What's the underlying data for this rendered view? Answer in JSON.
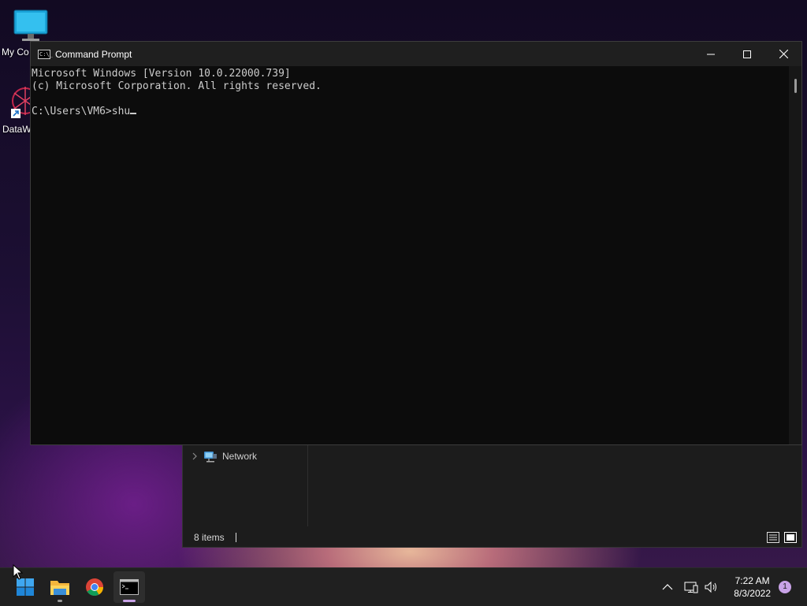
{
  "desktop": {
    "icons": [
      {
        "label": "My Co",
        "icon": "monitor-icon"
      },
      {
        "label": "DataW",
        "icon": "datawrangler-shortcut-icon"
      }
    ]
  },
  "explorer": {
    "nav": {
      "network_label": "Network"
    },
    "status": {
      "items_count": "8 items"
    }
  },
  "cmd": {
    "title": "Command Prompt",
    "icon_text": "C:\\_",
    "lines": [
      "Microsoft Windows [Version 10.0.22000.739]",
      "(c) Microsoft Corporation. All rights reserved.",
      "",
      "C:\\Users\\VM6>shu"
    ],
    "buttons": {
      "minimize": "minimize",
      "maximize": "maximize",
      "close": "close"
    }
  },
  "taskbar": {
    "apps": [
      {
        "name": "Start",
        "icon": "windows-start-icon"
      },
      {
        "name": "File Explorer",
        "icon": "folder-icon"
      },
      {
        "name": "Google Chrome",
        "icon": "chrome-icon"
      },
      {
        "name": "Command Prompt",
        "icon": "terminal-icon"
      }
    ],
    "clock": {
      "time": "7:22 AM",
      "date": "8/3/2022"
    },
    "notifications": "1"
  },
  "colors": {
    "console_bg": "#0c0c0c",
    "console_text": "#cccccc",
    "titlebar_bg": "#1f1f1f",
    "taskbar_bg": "#202020",
    "accent_indicator": "#c9a3e8"
  }
}
